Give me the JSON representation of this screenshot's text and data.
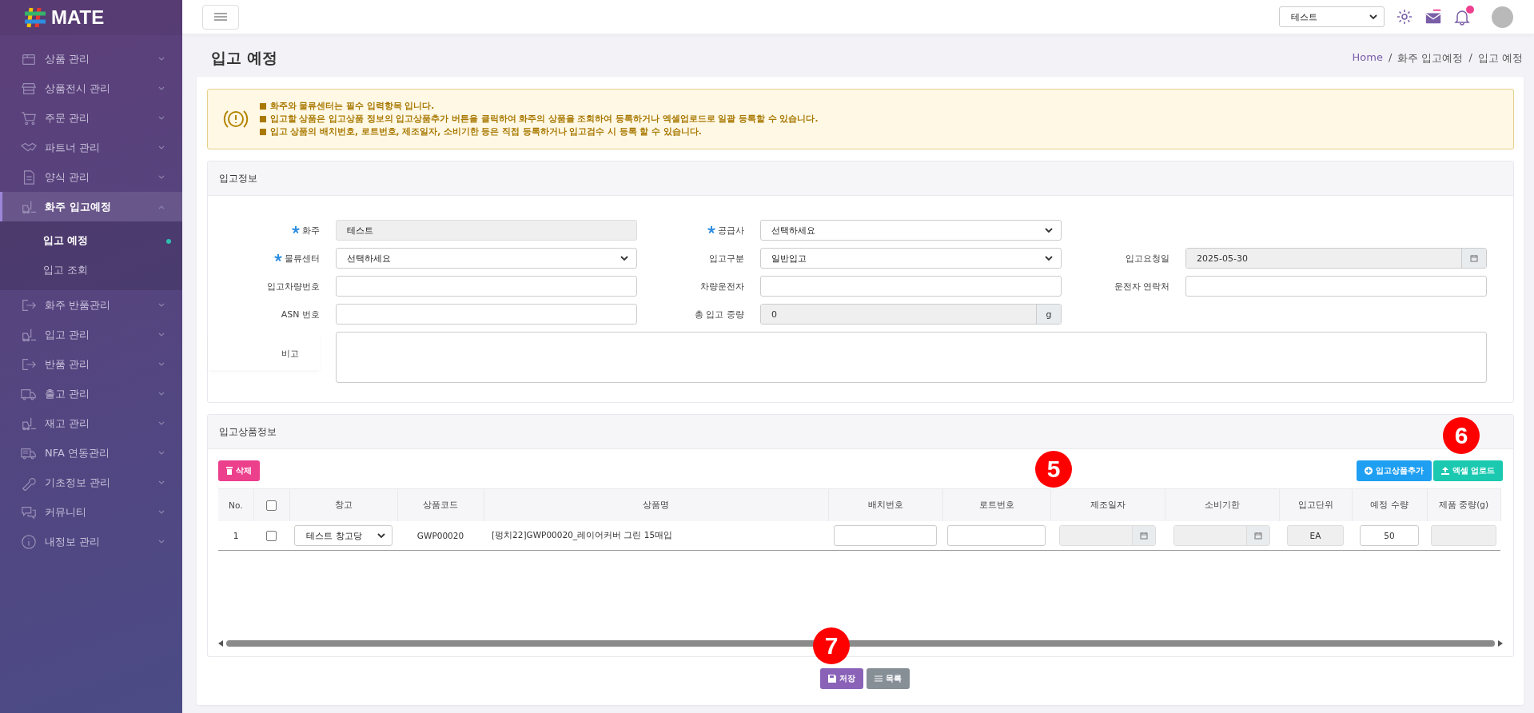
{
  "brand": {
    "name": "MATE"
  },
  "sidebar": {
    "items": [
      {
        "label": "상품 관리",
        "selected": false,
        "expanded": false
      },
      {
        "label": "상품전시 관리",
        "selected": false,
        "expanded": false
      },
      {
        "label": "주문 관리",
        "selected": false,
        "expanded": false
      },
      {
        "label": "파트너 관리",
        "selected": false,
        "expanded": false
      },
      {
        "label": "양식 관리",
        "selected": false,
        "expanded": false
      },
      {
        "label": "화주 입고예정",
        "selected": true,
        "expanded": true,
        "children": [
          {
            "label": "입고 예정",
            "selected": true
          },
          {
            "label": "입고 조회",
            "selected": false
          }
        ]
      },
      {
        "label": "화주 반품관리",
        "selected": false,
        "expanded": false
      },
      {
        "label": "입고 관리",
        "selected": false,
        "expanded": false
      },
      {
        "label": "반품 관리",
        "selected": false,
        "expanded": false
      },
      {
        "label": "출고 관리",
        "selected": false,
        "expanded": false
      },
      {
        "label": "재고 관리",
        "selected": false,
        "expanded": false
      },
      {
        "label": "NFA 연동관리",
        "selected": false,
        "expanded": false
      },
      {
        "label": "기초정보 관리",
        "selected": false,
        "expanded": false
      },
      {
        "label": "커뮤니티",
        "selected": false,
        "expanded": false
      },
      {
        "label": "내정보 관리",
        "selected": false,
        "expanded": false
      }
    ]
  },
  "topbar": {
    "company_select": "테스트",
    "has_notification": true
  },
  "page": {
    "title": "입고 예정",
    "breadcrumb": [
      "Home",
      "화주 입고예정",
      "입고 예정"
    ],
    "breadcrumb_separator": "/"
  },
  "notice": {
    "lines": [
      "■ 화주와 물류센터는 필수 입력항목 입니다.",
      "■ 입고할 상품은 입고상품 정보의 입고상품추가 버튼을 클릭하여 화주의 상품을 조회하여 등록하거나 엑셀업로드로 일괄 등록할 수 있습니다.",
      "■ 입고 상품의 배치번호, 로트번호, 제조일자, 소비기한 등은 직접 등록하거나 입고검수 시 등록 할 수 있습니다."
    ]
  },
  "info_panel": {
    "title": "입고정보",
    "rows": [
      [
        {
          "label": "화주",
          "required": true,
          "kind": "readonly",
          "value": "테스트"
        },
        {
          "label": "공급사",
          "required": true,
          "kind": "select",
          "value": "선택하세요"
        }
      ],
      [
        {
          "label": "물류센터",
          "required": true,
          "kind": "select",
          "value": "선택하세요"
        },
        {
          "label": "입고구분",
          "required": false,
          "kind": "select",
          "value": "일반입고"
        },
        {
          "label": "입고요청일",
          "required": false,
          "kind": "date",
          "value": "2025-05-30"
        }
      ],
      [
        {
          "label": "입고차량번호",
          "required": false,
          "kind": "input"
        },
        {
          "label": "차량운전자",
          "required": false,
          "kind": "input"
        },
        {
          "label": "운전자 연락처",
          "required": false,
          "kind": "input"
        }
      ],
      [
        {
          "label": "ASN 번호",
          "required": false,
          "kind": "input"
        },
        {
          "label": "총 입고 중량",
          "required": false,
          "kind": "unit",
          "value": "0",
          "unit": "g"
        }
      ],
      [
        {
          "label": "비고",
          "required": false,
          "kind": "textarea"
        }
      ]
    ]
  },
  "products_panel": {
    "title": "입고상품정보",
    "delete_button": "삭제",
    "add_button": "입고상품추가",
    "excel_button": "엑셀 업로드",
    "select_all_checked": false,
    "columns": [
      "No.",
      "",
      "창고",
      "상품코드",
      "상품명",
      "배치번호",
      "로트번호",
      "제조일자",
      "소비기한",
      "입고단위",
      "예정 수량",
      "제품 중량(g)"
    ],
    "rows": [
      {
        "no": "1",
        "checked": false,
        "warehouse": "테스트 창고당",
        "product_code": "GWP00020",
        "product_name": "[펑치22]GWP00020_레이어커버 그린 15매입",
        "unit": "EA",
        "quantity": "50"
      }
    ]
  },
  "actions": {
    "save": "저장",
    "list": "목록"
  },
  "callouts": [
    {
      "label": "5"
    },
    {
      "label": "6"
    },
    {
      "label": "7"
    }
  ]
}
